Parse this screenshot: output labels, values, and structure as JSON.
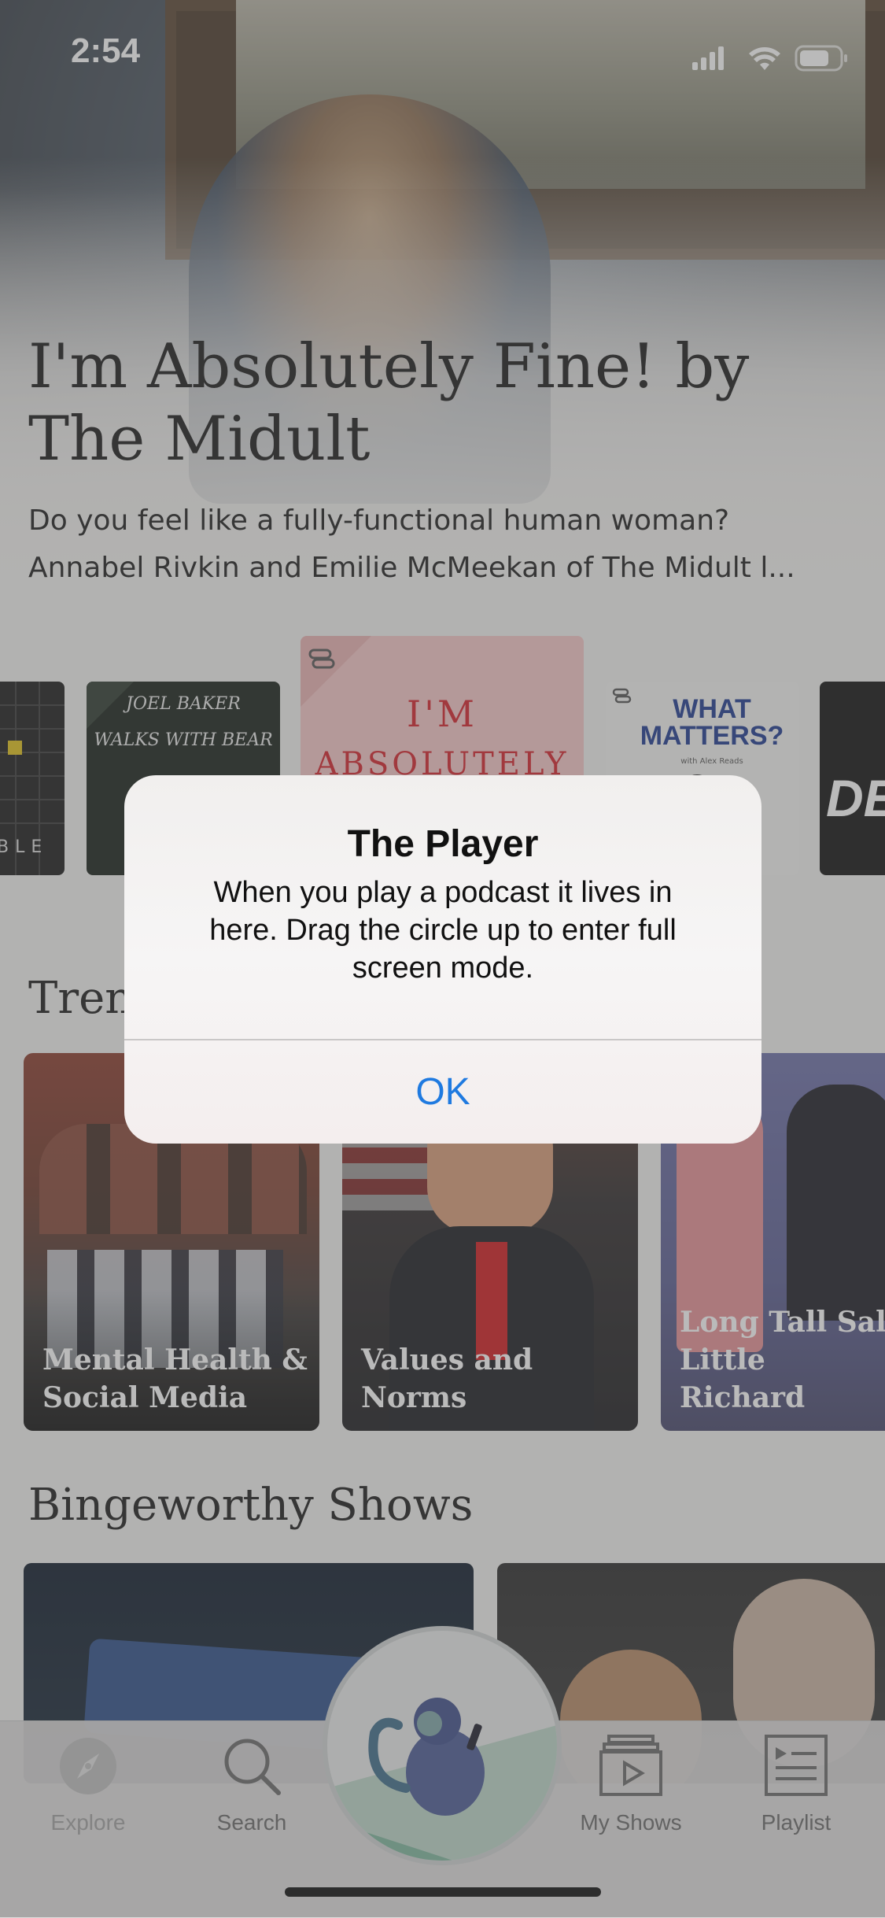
{
  "status_bar": {
    "time": "2:54"
  },
  "hero": {
    "title": "I'm Absolutely Fine! by The Midult",
    "description_line1": "Do you feel like a fully-functional human woman?",
    "description_line2": "Annabel Rivkin and Emilie McMeekan of The Midult l..."
  },
  "carousel": {
    "tiles": [
      {
        "text": "BLE"
      },
      {
        "text_top": "JOEL BAKER",
        "text_bottom": "WALKS WITH BEAR"
      },
      {
        "text_top": "I'M",
        "text_bottom": "ABSOLUTELY"
      },
      {
        "text_top": "WHAT MATTERS?",
        "text_bottom": "with Alex Reads"
      },
      {
        "text": "DE"
      }
    ]
  },
  "trending": {
    "title": "Trending",
    "visible_title": "Trenc",
    "cards": [
      {
        "label_line1": "Mental Health &",
        "label_line2": "Social Media"
      },
      {
        "label_line1": "",
        "label_line2": "Values and Norms"
      },
      {
        "label_line1": "Long Tall Sally –",
        "label_line2": "Little Richard"
      }
    ]
  },
  "bingeworthy": {
    "title": "Bingeworthy Shows"
  },
  "alert": {
    "title": "The Player",
    "message": "When you play a podcast it lives in here. Drag the circle up to enter full screen mode.",
    "ok_label": "OK"
  },
  "tabbar": {
    "tabs": [
      {
        "label": "Explore",
        "icon": "compass-icon"
      },
      {
        "label": "Search",
        "icon": "search-icon"
      },
      {
        "label": "My Shows",
        "icon": "my-shows-icon"
      },
      {
        "label": "Playlist",
        "icon": "playlist-icon"
      }
    ]
  },
  "colors": {
    "accent": "#1f7ae0",
    "tab_text": "#8a8a8a",
    "tab_text_active": "#5a5a5a"
  }
}
